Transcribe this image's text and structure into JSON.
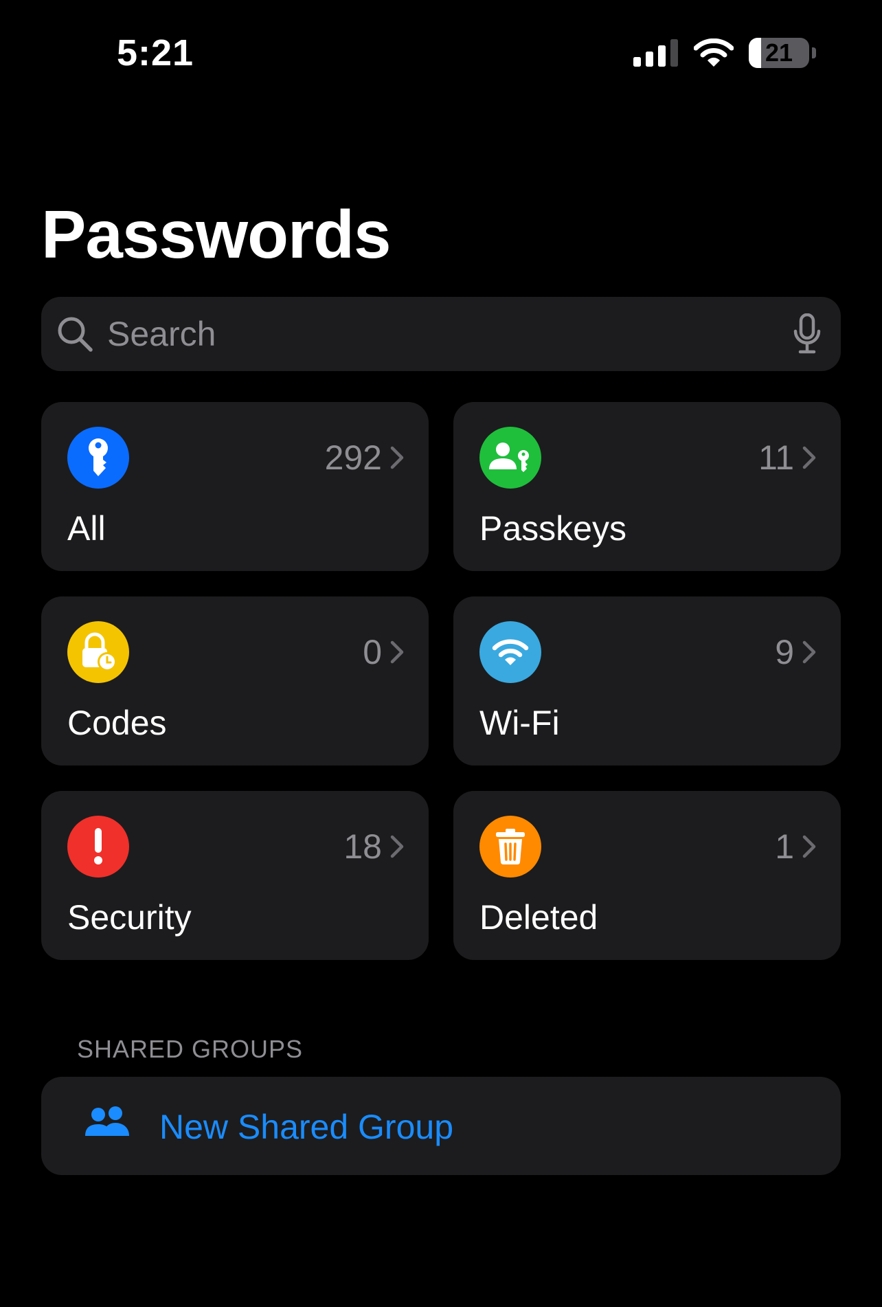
{
  "status_bar": {
    "time": "5:21",
    "battery_level": "21",
    "battery_fraction": 0.21,
    "icons": [
      "cellular-signal-icon",
      "wifi-icon",
      "battery-icon"
    ]
  },
  "header": {
    "title": "Passwords"
  },
  "search": {
    "placeholder": "Search",
    "value": "",
    "icons": [
      "search-icon",
      "microphone-icon"
    ]
  },
  "categories": [
    {
      "label": "All",
      "count": "292",
      "icon": "key-icon",
      "color": "#0a6cff"
    },
    {
      "label": "Passkeys",
      "count": "11",
      "icon": "person-key-icon",
      "color": "#1fbf3c"
    },
    {
      "label": "Codes",
      "count": "0",
      "icon": "lock-clock-icon",
      "color": "#f4c400"
    },
    {
      "label": "Wi-Fi",
      "count": "9",
      "icon": "wifi-icon",
      "color": "#3aa9e0"
    },
    {
      "label": "Security",
      "count": "18",
      "icon": "exclamation-icon",
      "color": "#f0302a"
    },
    {
      "label": "Deleted",
      "count": "1",
      "icon": "trash-icon",
      "color": "#ff8a00"
    }
  ],
  "shared_groups": {
    "header": "SHARED GROUPS",
    "new_group_label": "New Shared Group",
    "icon": "people-icon",
    "accent_color": "#1a8cff"
  }
}
